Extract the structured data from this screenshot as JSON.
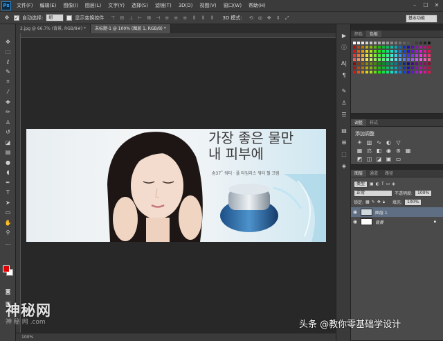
{
  "app": {
    "logo": "Ps"
  },
  "menu": [
    "文件(F)",
    "编辑(E)",
    "图像(I)",
    "图层(L)",
    "文字(Y)",
    "选择(S)",
    "滤镜(T)",
    "3D(D)",
    "视图(V)",
    "窗口(W)",
    "帮助(H)"
  ],
  "options": {
    "auto_select_label": "自动选择:",
    "auto_select_value": "组",
    "show_transform_label": "显示变换控件",
    "mode_3d_label": "3D 模式:",
    "workspace": "基本功能"
  },
  "tabs": [
    {
      "label": "2.jpg @ 66.7% (背景, RGB/8#) *",
      "active": false
    },
    {
      "label": "未标题-1 @ 100% (图层 1, RGB/8) *",
      "active": true
    }
  ],
  "document": {
    "headline_line1": "가장 좋은 물만",
    "headline_line2": "내 피부에",
    "subline": "숨37˚ 워터 · 풀 타임리스 워터 젤 크림"
  },
  "panels": {
    "swatches_tabs": [
      "颜色",
      "色板"
    ],
    "adjust_tabs": [
      "调整",
      "样式"
    ],
    "adjust_title": "添加调整",
    "layers_tabs": [
      "图层",
      "通道",
      "路径"
    ],
    "filter_kind": "类型",
    "blend_mode": "正常",
    "opacity_label": "不透明度:",
    "opacity_value": "100%",
    "lock_label": "锁定:",
    "fill_label": "填充:",
    "fill_value": "100%",
    "layers": [
      {
        "name": "图层 1",
        "selected": true
      },
      {
        "name": "背景",
        "selected": false
      }
    ]
  },
  "status": {
    "zoom": "100%"
  },
  "watermarks": {
    "left": "神秘网",
    "left_url": "神 秘 网 .com",
    "right": "头条 @教你零基础学设计"
  },
  "colors": {
    "foreground": "#e00000",
    "background": "#ffffff",
    "accent": "#31a8ff"
  }
}
